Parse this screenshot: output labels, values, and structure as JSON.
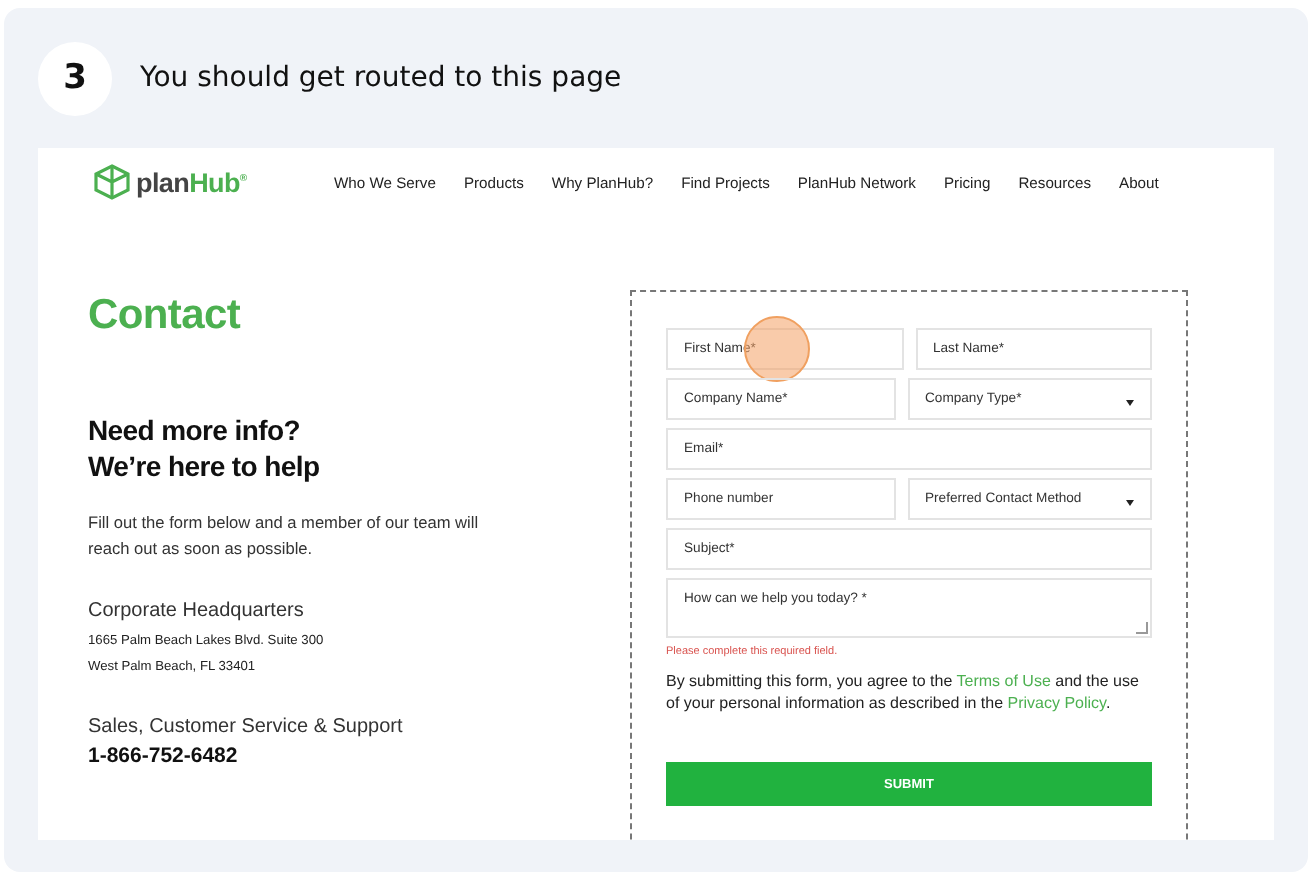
{
  "step": {
    "number": "3",
    "text": "You should get routed to this page"
  },
  "site": {
    "logo": {
      "prefix": "plan",
      "accent": "Hub",
      "mark": "®"
    },
    "nav": [
      "Who We Serve",
      "Products",
      "Why PlanHub?",
      "Find Projects",
      "PlanHub Network",
      "Pricing",
      "Resources",
      "About"
    ],
    "heading": "Contact",
    "subheading": [
      "Need more info?",
      "We’re here to help"
    ],
    "intro": "Fill out the form below and a member of our team will reach out as soon as possible.",
    "hq": {
      "label": "Corporate Headquarters",
      "lines": [
        "1665 Palm Beach Lakes Blvd. Suite 300",
        "West Palm Beach, FL 33401"
      ]
    },
    "support": {
      "label": "Sales, Customer Service & Support",
      "phone": "1-866-752-6482"
    },
    "form": {
      "rows": [
        [
          {
            "kind": "text",
            "placeholder": "First Name*",
            "highlighted": true
          },
          {
            "kind": "text",
            "placeholder": "Last Name*",
            "highlighted": false
          }
        ],
        [
          {
            "kind": "text",
            "placeholder": "Company Name*",
            "highlighted": false
          },
          {
            "kind": "select",
            "placeholder": "Company Type*",
            "highlighted": false
          }
        ],
        [
          {
            "kind": "text",
            "placeholder": "Email*",
            "highlighted": false
          }
        ],
        [
          {
            "kind": "text",
            "placeholder": "Phone number",
            "highlighted": false
          },
          {
            "kind": "select",
            "placeholder": "Preferred Contact Method",
            "highlighted": false
          }
        ],
        [
          {
            "kind": "text",
            "placeholder": "Subject*",
            "highlighted": false
          }
        ],
        [
          {
            "kind": "textarea",
            "placeholder": "How can we help you today? *",
            "highlighted": false
          }
        ]
      ],
      "error": "Please complete this required field.",
      "consent": [
        "By submitting this form, you agree to the ",
        {
          "link": "Terms of Use"
        },
        " and the use of your personal information as described in the ",
        {
          "link": "Privacy Policy"
        },
        "."
      ],
      "submit": "SUBMIT"
    }
  }
}
